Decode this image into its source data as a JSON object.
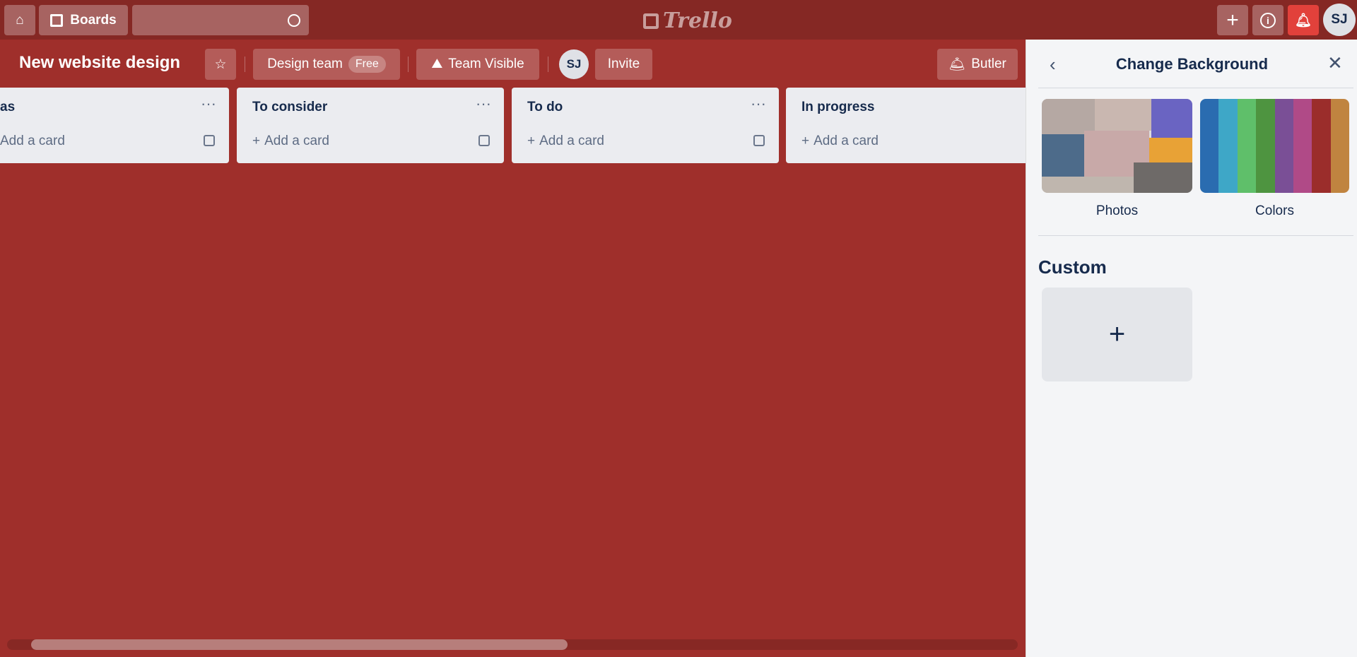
{
  "topbar": {
    "boards_label": "Boards",
    "search_placeholder": "",
    "logo": "Trello",
    "avatar_initials": "SJ"
  },
  "board": {
    "title": "New website design",
    "team_name": "Design team",
    "team_badge": "Free",
    "visibility": "Team Visible",
    "member_initials": "SJ",
    "invite_label": "Invite",
    "butler_label": "Butler"
  },
  "lists": [
    {
      "title": "as",
      "add_label": "Add a card"
    },
    {
      "title": "To consider",
      "add_label": "Add a card"
    },
    {
      "title": "To do",
      "add_label": "Add a card"
    },
    {
      "title": "In progress",
      "add_label": "Add a card"
    }
  ],
  "panel": {
    "title": "Change Background",
    "photos_label": "Photos",
    "colors_label": "Colors",
    "custom_heading": "Custom"
  },
  "colors": {
    "board_bg": "#9f2f2b",
    "topbar_bg": "#852824",
    "notification": "#e2413b",
    "swatches": [
      "#2a6cb0",
      "#3ea7c7",
      "#5fbf6a",
      "#4e9440",
      "#7a4f96",
      "#b04a87",
      "#9b2d2b",
      "#c08440"
    ]
  }
}
